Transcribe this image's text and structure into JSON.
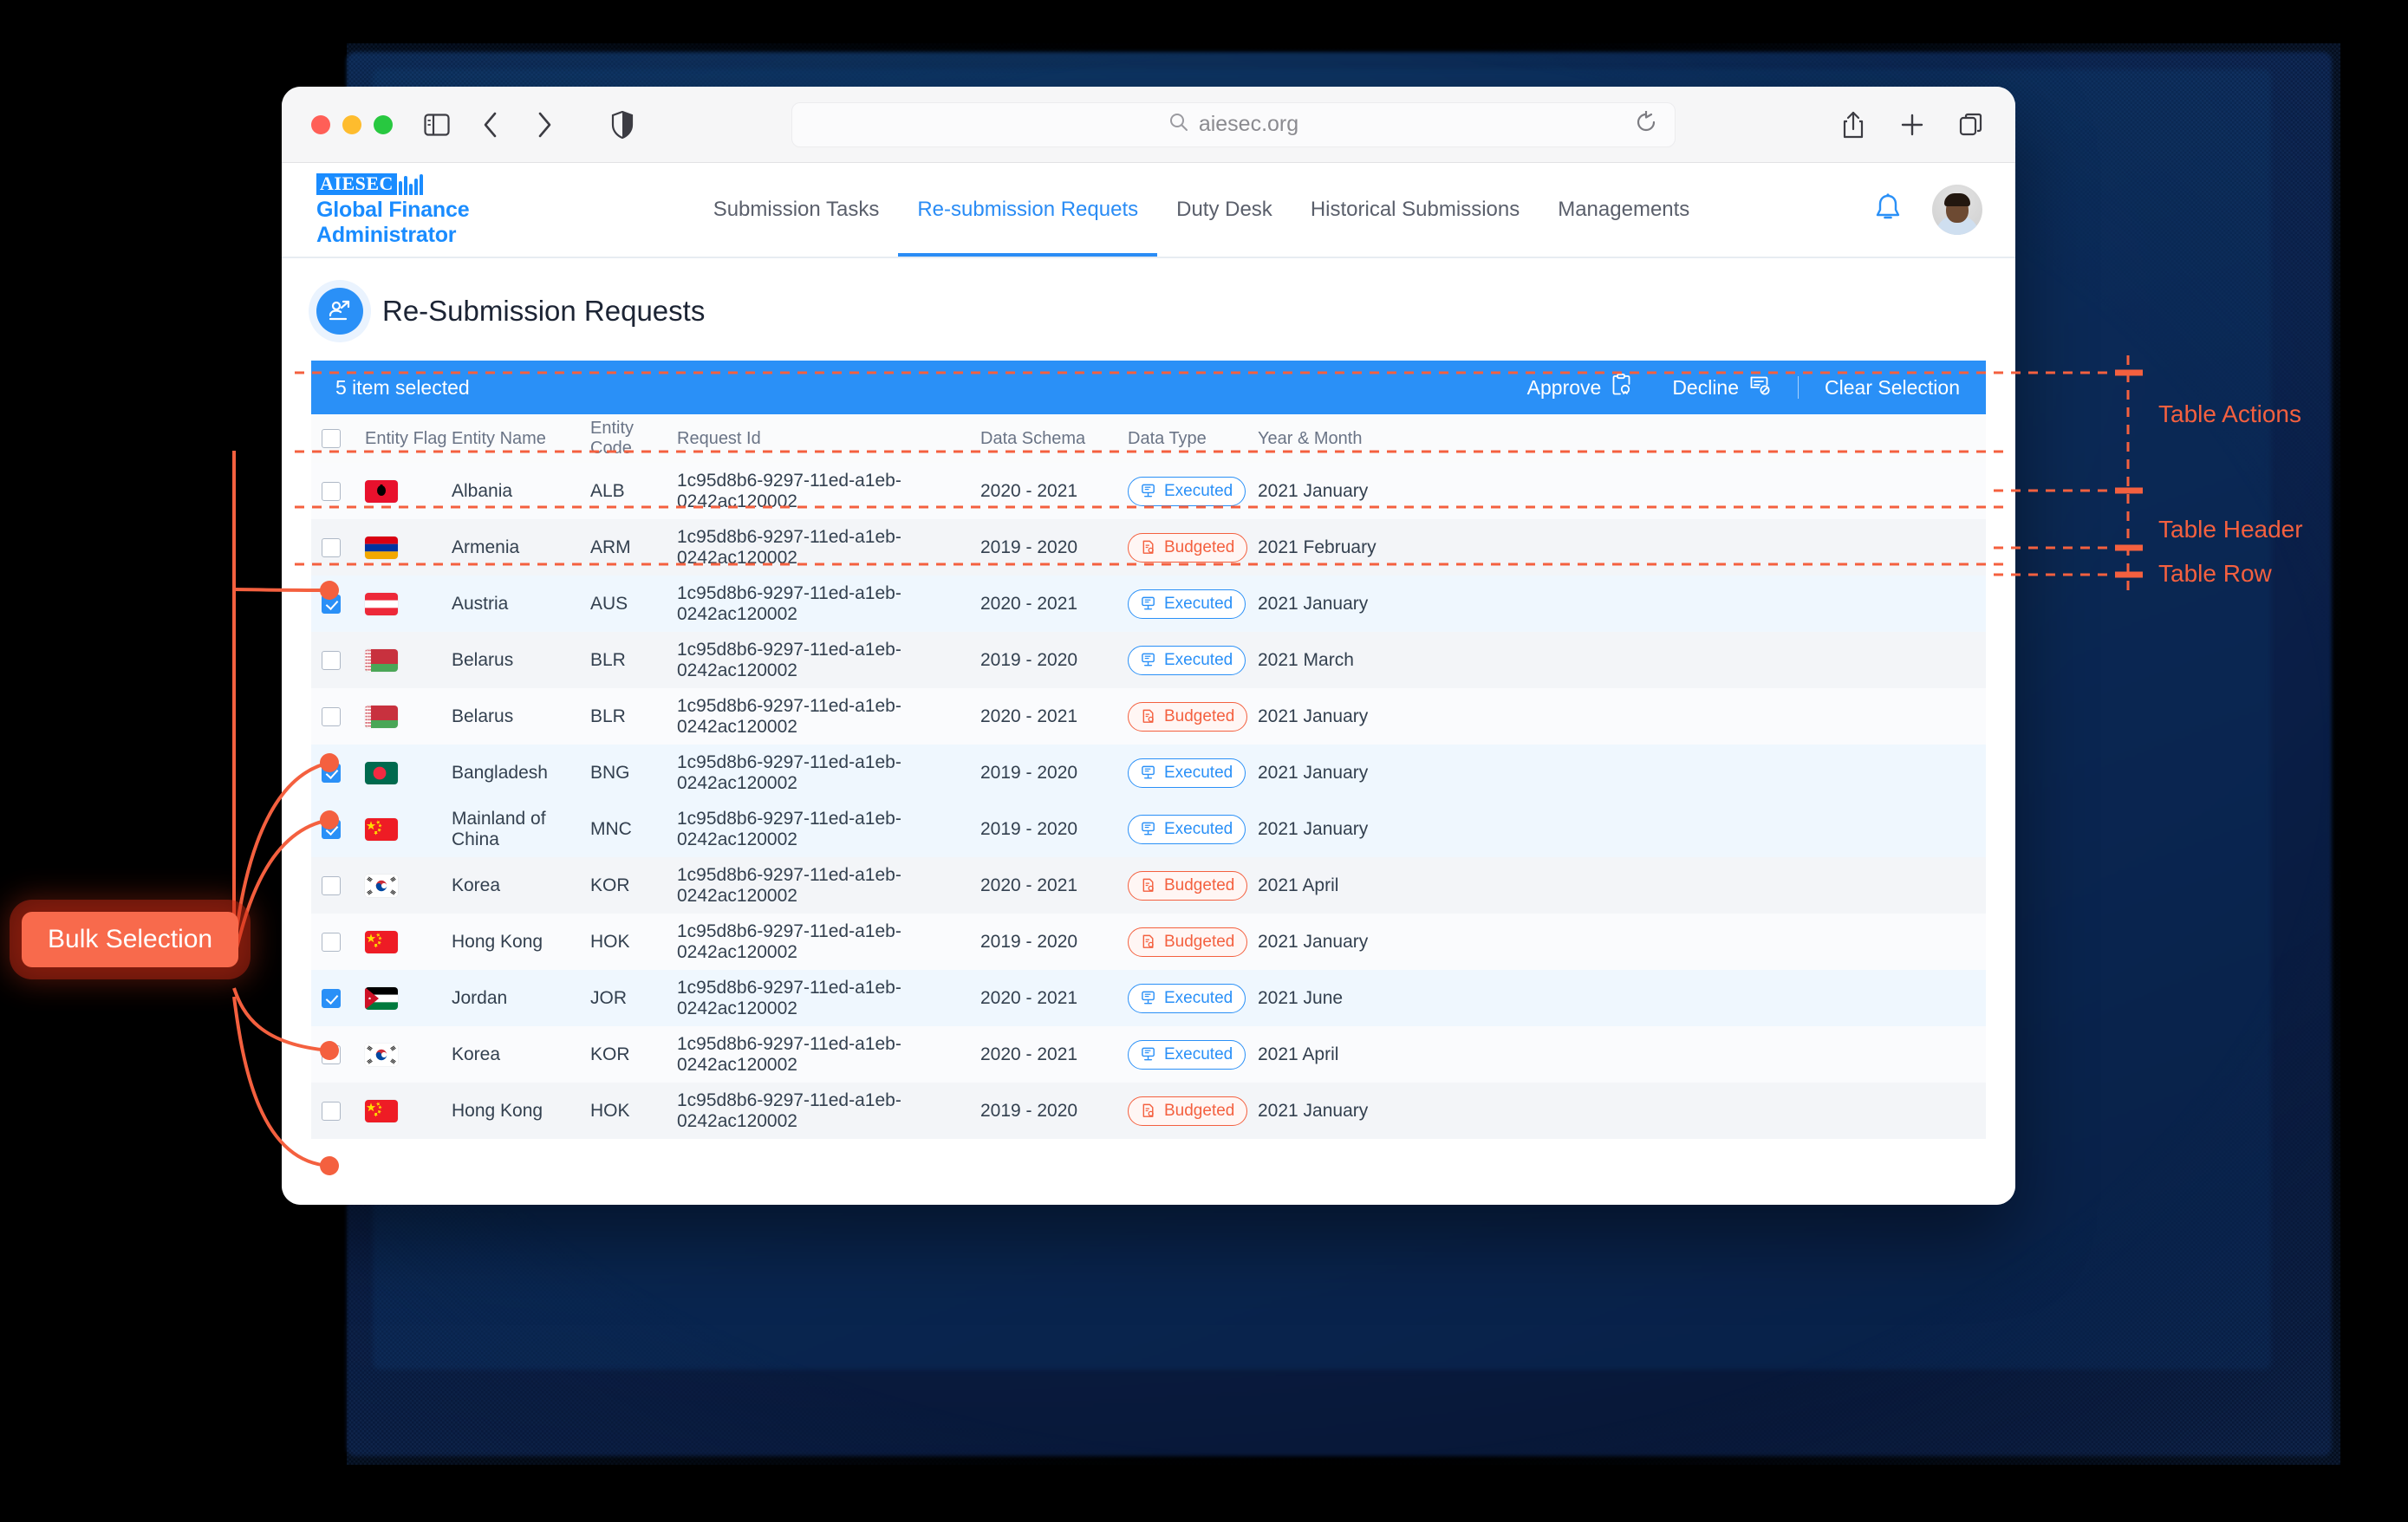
{
  "browser": {
    "url": "aiesec.org",
    "traffic_lights": [
      "close",
      "minimize",
      "maximize"
    ],
    "icons": {
      "sidebar": "sidebar-icon",
      "back": "back-chevron-icon",
      "forward": "forward-chevron-icon",
      "shield": "shield-icon",
      "search": "search-icon",
      "reload": "reload-icon",
      "share": "share-icon",
      "new_tab": "plus-icon",
      "tab_overview": "tab-overview-icon"
    }
  },
  "header": {
    "brand_logo": "AIESEC",
    "brand_subtitle": "Global Finance Administrator",
    "nav": [
      {
        "label": "Submission Tasks",
        "active": false
      },
      {
        "label": "Re-submission Requets",
        "active": true
      },
      {
        "label": "Duty Desk",
        "active": false
      },
      {
        "label": "Historical Submissions",
        "active": false
      },
      {
        "label": "Managements",
        "active": false
      }
    ],
    "bell_icon": "bell-icon",
    "avatar": "user-avatar"
  },
  "page": {
    "title": "Re-Submission Requests",
    "title_icon": "user-share-icon"
  },
  "actions_bar": {
    "selection_text": "5 item selected",
    "approve_label": "Approve",
    "approve_icon": "clipboard-check-icon",
    "decline_label": "Decline",
    "decline_icon": "document-block-icon",
    "clear_label": "Clear Selection"
  },
  "table": {
    "columns": [
      "",
      "Entity Flag",
      "Entity Name",
      "Entity Code",
      "Request Id",
      "Data Schema",
      "Data Type",
      "Year & Month"
    ],
    "header_checkbox": false,
    "rows": [
      {
        "checked": false,
        "flag": "albania",
        "name": "Albania",
        "code": "ALB",
        "request_id": "1c95d8b6-9297-11ed-a1eb-0242ac120002",
        "schema": "2020 - 2021",
        "type": "Executed",
        "year_month": "2021 January"
      },
      {
        "checked": false,
        "flag": "armenia",
        "name": "Armenia",
        "code": "ARM",
        "request_id": "1c95d8b6-9297-11ed-a1eb-0242ac120002",
        "schema": "2019 - 2020",
        "type": "Budgeted",
        "year_month": "2021 February"
      },
      {
        "checked": true,
        "flag": "austria",
        "name": "Austria",
        "code": "AUS",
        "request_id": "1c95d8b6-9297-11ed-a1eb-0242ac120002",
        "schema": "2020 - 2021",
        "type": "Executed",
        "year_month": "2021 January"
      },
      {
        "checked": false,
        "flag": "belarus",
        "name": "Belarus",
        "code": "BLR",
        "request_id": "1c95d8b6-9297-11ed-a1eb-0242ac120002",
        "schema": "2019 - 2020",
        "type": "Executed",
        "year_month": "2021 March"
      },
      {
        "checked": false,
        "flag": "belarus",
        "name": "Belarus",
        "code": "BLR",
        "request_id": "1c95d8b6-9297-11ed-a1eb-0242ac120002",
        "schema": "2020 - 2021",
        "type": "Budgeted",
        "year_month": "2021 January"
      },
      {
        "checked": true,
        "flag": "bangladesh",
        "name": "Bangladesh",
        "code": "BNG",
        "request_id": "1c95d8b6-9297-11ed-a1eb-0242ac120002",
        "schema": "2019 - 2020",
        "type": "Executed",
        "year_month": "2021 January"
      },
      {
        "checked": true,
        "flag": "china",
        "name": "Mainland of China",
        "code": "MNC",
        "request_id": "1c95d8b6-9297-11ed-a1eb-0242ac120002",
        "schema": "2019 - 2020",
        "type": "Executed",
        "year_month": "2021 January"
      },
      {
        "checked": false,
        "flag": "korea",
        "name": "Korea",
        "code": "KOR",
        "request_id": "1c95d8b6-9297-11ed-a1eb-0242ac120002",
        "schema": "2020 - 2021",
        "type": "Budgeted",
        "year_month": "2021 April"
      },
      {
        "checked": false,
        "flag": "china",
        "name": "Hong Kong",
        "code": "HOK",
        "request_id": "1c95d8b6-9297-11ed-a1eb-0242ac120002",
        "schema": "2019 - 2020",
        "type": "Budgeted",
        "year_month": "2021 January"
      },
      {
        "checked": true,
        "flag": "jordan",
        "name": "Jordan",
        "code": "JOR",
        "request_id": "1c95d8b6-9297-11ed-a1eb-0242ac120002",
        "schema": "2020 - 2021",
        "type": "Executed",
        "year_month": "2021 June"
      },
      {
        "checked": false,
        "flag": "korea",
        "name": "Korea",
        "code": "KOR",
        "request_id": "1c95d8b6-9297-11ed-a1eb-0242ac120002",
        "schema": "2020 - 2021",
        "type": "Executed",
        "year_month": "2021 April"
      },
      {
        "checked": false,
        "flag": "china",
        "name": "Hong Kong",
        "code": "HOK",
        "request_id": "1c95d8b6-9297-11ed-a1eb-0242ac120002",
        "schema": "2019 - 2020",
        "type": "Budgeted",
        "year_month": "2021 January"
      }
    ]
  },
  "annotations": {
    "bulk_selection": "Bulk Selection",
    "table_actions": "Table Actions",
    "table_header": "Table Header",
    "table_row": "Table Row"
  },
  "colors": {
    "accent": "#2a90f7",
    "annotation": "#f4603f",
    "budgeted": "#f4603f",
    "executed": "#2a90f7"
  }
}
